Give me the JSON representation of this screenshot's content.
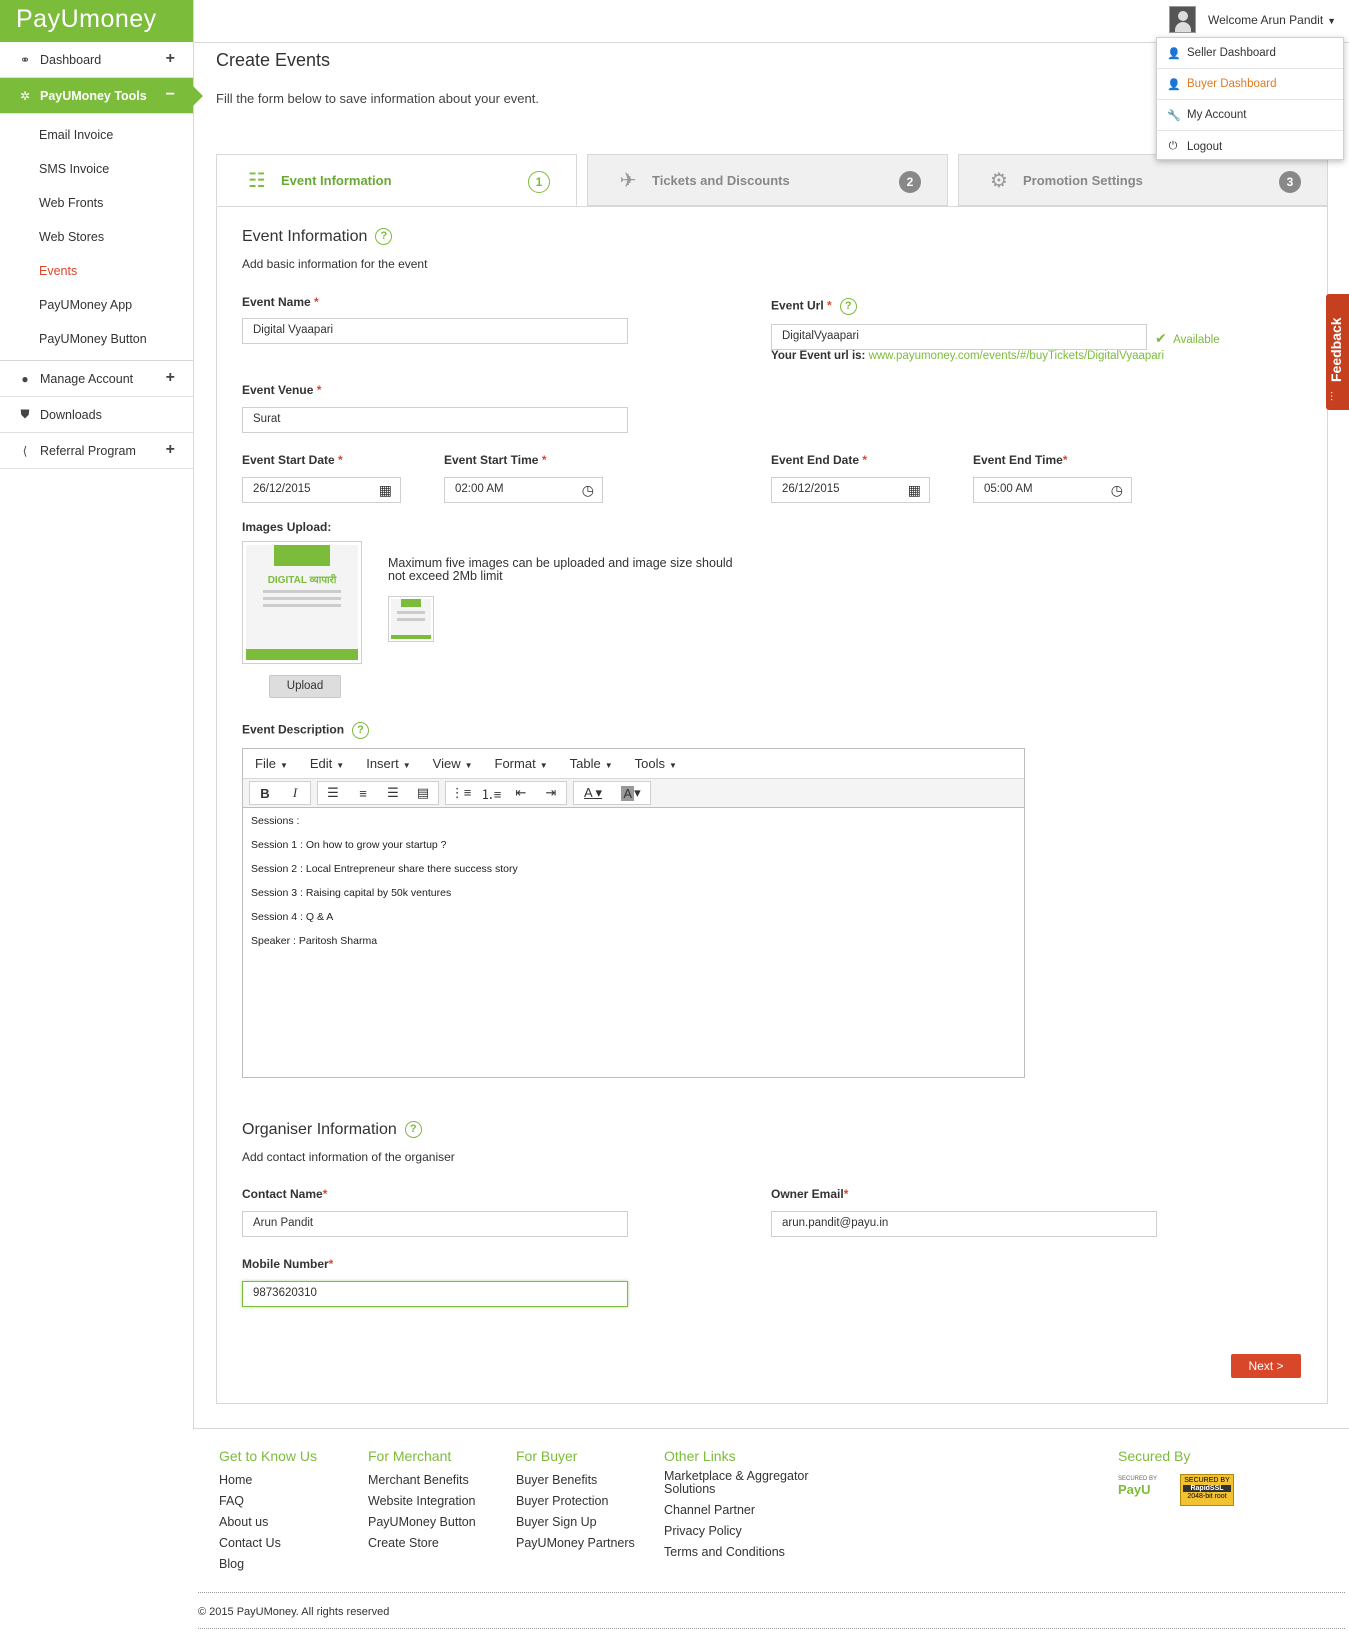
{
  "brand": {
    "name": "PayUmoney",
    "color": "#7cbc3b"
  },
  "sidebar": {
    "items": [
      {
        "label": "Dashboard",
        "icon": "dashboard-icon",
        "expander": "+"
      },
      {
        "label": "PayUMoney Tools",
        "icon": "tools-icon",
        "expander": "−"
      }
    ],
    "sub_items": [
      "Email Invoice",
      "SMS Invoice",
      "Web Fronts",
      "Web Stores",
      "Events",
      "PayUMoney App",
      "PayUMoney Button"
    ],
    "bottom_items": [
      {
        "label": "Manage Account",
        "icon": "user-icon",
        "expander": "+"
      },
      {
        "label": "Downloads",
        "icon": "download-icon",
        "expander": ""
      },
      {
        "label": "Referral Program",
        "icon": "share-icon",
        "expander": "+"
      }
    ]
  },
  "header": {
    "welcome": "Welcome Arun Pandit",
    "menu": [
      "Seller Dashboard",
      "Buyer Dashboard",
      "My Account",
      "Logout"
    ]
  },
  "page": {
    "title": "Create Events",
    "subtitle": "Fill the form below to save information about your event."
  },
  "tabs": [
    {
      "label": "Event Information",
      "num": "1"
    },
    {
      "label": "Tickets and Discounts",
      "num": "2"
    },
    {
      "label": "Promotion Settings",
      "num": "3"
    }
  ],
  "event_info": {
    "title": "Event Information",
    "subtitle": "Add basic information for the event",
    "name_label": "Event Name",
    "name_value": "Digital Vyaapari",
    "url_label": "Event Url",
    "url_value": "DigitalVyaapari",
    "available": "Available",
    "url_prefix": "Your Event url is:",
    "url_link": "www.payumoney.com/events/#/buyTickets/DigitalVyaapari",
    "venue_label": "Event Venue",
    "venue_value": "Surat",
    "start_date_label": "Event Start Date",
    "start_date": "26/12/2015",
    "start_time_label": "Event Start Time",
    "start_time": "02:00 AM",
    "end_date_label": "Event End Date",
    "end_date": "26/12/2015",
    "end_time_label": "Event End Time",
    "end_time": "05:00 AM",
    "images_label": "Images Upload:",
    "images_note": "Maximum five images can be uploaded and image size should not exceed 2Mb limit",
    "poster_title": "DIGITAL",
    "poster_hindi": "व्यापारी",
    "upload_btn": "Upload",
    "desc_label": "Event Description"
  },
  "editor": {
    "menus": [
      "File",
      "Edit",
      "Insert",
      "View",
      "Format",
      "Table",
      "Tools"
    ],
    "lines": [
      "Sessions :",
      "Session 1 :   On how to grow your startup ?",
      "Session 2  :  Local Entrepreneur share there success story",
      "Session 3 :  Raising capital by 50k ventures",
      "Session 4 :  Q & A",
      "Speaker : Paritosh Sharma"
    ]
  },
  "organiser": {
    "title": "Organiser Information",
    "subtitle": "Add contact information of the organiser",
    "contact_label": "Contact Name",
    "contact_value": "Arun Pandit",
    "email_label": "Owner Email",
    "email_value": "arun.pandit@payu.in",
    "mobile_label": "Mobile Number",
    "mobile_value": "9873620310"
  },
  "next_btn": "Next >",
  "feedback": "Feedback",
  "footer": {
    "cols": [
      {
        "title": "Get to Know Us",
        "links": [
          "Home",
          "FAQ",
          "About us",
          "Contact Us",
          "Blog"
        ]
      },
      {
        "title": "For Merchant",
        "links": [
          "Merchant Benefits",
          "Website Integration",
          "PayUMoney Button",
          "Create Store"
        ]
      },
      {
        "title": "For Buyer",
        "links": [
          "Buyer Benefits",
          "Buyer Protection",
          "Buyer Sign Up",
          "PayUMoney Partners"
        ]
      },
      {
        "title": "Other Links",
        "links": [
          "Marketplace & Aggregator Solutions",
          "Channel Partner",
          "Privacy Policy",
          "Terms and Conditions"
        ]
      }
    ],
    "secured": "Secured By",
    "payu_small": "SECURED BY",
    "payu_badge": "PayU",
    "ssl_top": "SECURED BY",
    "ssl_name": "RapidSSL",
    "ssl_bottom": "2048-bit root",
    "copyright": "© 2015 PayUMoney. All rights reserved"
  }
}
